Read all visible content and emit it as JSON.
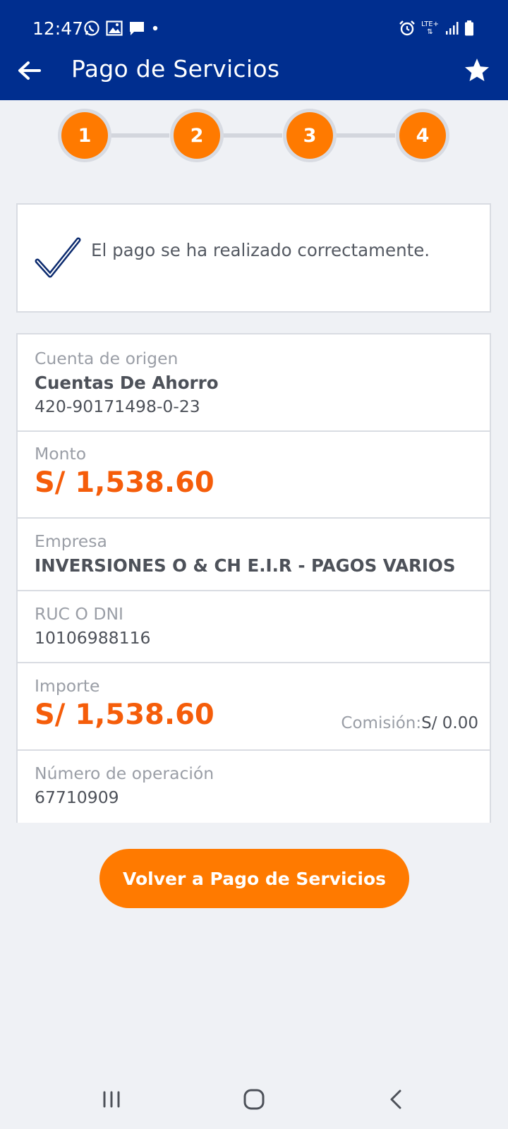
{
  "status_bar": {
    "time": "12:47",
    "left_icons": [
      "whatsapp-icon",
      "image-icon",
      "message-icon",
      "dot-icon"
    ],
    "right_icons": [
      "alarm-icon",
      "lte-icon",
      "signal-icon",
      "battery-icon"
    ],
    "network": "LTE+"
  },
  "header": {
    "title": "Pago de Servicios",
    "back_icon": "arrow-left-icon",
    "favorite_icon": "star-icon"
  },
  "stepper": {
    "steps": [
      "1",
      "2",
      "3",
      "4"
    ],
    "accent": "#ff7a00"
  },
  "success": {
    "message": "El pago se ha realizado correctamente.",
    "icon": "check-icon"
  },
  "details": {
    "source_account": {
      "label": "Cuenta de origen",
      "type": "Cuentas De Ahorro",
      "number": "420-90171498-0-23"
    },
    "amount": {
      "label": "Monto",
      "value": "S/ 1,538.60"
    },
    "company": {
      "label": "Empresa",
      "value": "INVERSIONES O & CH E.I.R - PAGOS VARIOS"
    },
    "ruc": {
      "label": "RUC O DNI",
      "value": "10106988116"
    },
    "importe": {
      "label": "Importe",
      "value": "S/ 1,538.60",
      "commission_label": "Comisión:",
      "commission_value": "S/ 0.00"
    },
    "operation": {
      "label": "Número de operación",
      "value": "67710909"
    }
  },
  "actions": {
    "return_label": "Volver a Pago de Servicios"
  },
  "nav_bar": {
    "icons": [
      "recent-apps-icon",
      "home-icon",
      "back-nav-icon"
    ]
  },
  "colors": {
    "header_bg": "#002e8f",
    "accent_orange": "#ff7a00",
    "amount_orange": "#f55d0a",
    "background": "#eff1f5"
  }
}
